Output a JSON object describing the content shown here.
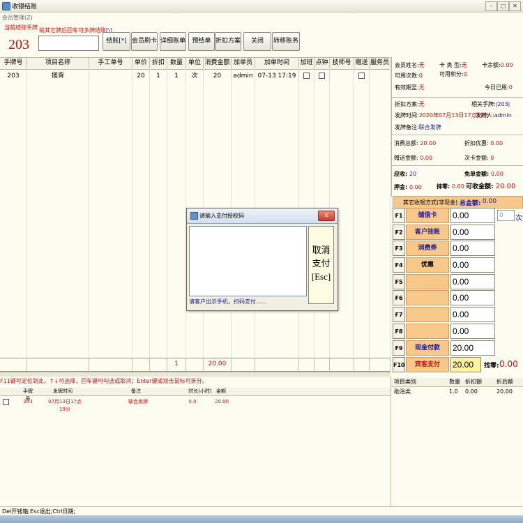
{
  "window": {
    "title": "收银结账"
  },
  "menu": {
    "label": "会员管理(Z)"
  },
  "header": {
    "current_label": "当前结账手牌",
    "current_number": "203",
    "hint_text": "输其它牌后回车可多牌结账",
    "hint_suffix": "[\\]",
    "code_value": ""
  },
  "toolbar": {
    "buttons": [
      {
        "label": "结账[*]"
      },
      {
        "label": "会员刷卡"
      },
      {
        "label": "详细账单"
      },
      {
        "label": "预结单"
      },
      {
        "label": "折扣方案"
      },
      {
        "label": "关闭"
      },
      {
        "label": "转移账务"
      }
    ]
  },
  "grid": {
    "columns": [
      "手牌号",
      "项目名称",
      "手工单号",
      "单价",
      "折扣",
      "数量",
      "单位",
      "消费金额",
      "加单员",
      "加单时间",
      "加班",
      "点钟",
      "技师号",
      "赠送",
      "服务员"
    ],
    "rows": [
      {
        "tag": "203",
        "item": "搓背",
        "manual": "",
        "price": "20",
        "discount": "1",
        "qty": "1",
        "unit": "次",
        "amount": "20",
        "operator": "admin",
        "time": "07-13 17:19",
        "tech": ""
      }
    ],
    "summary": {
      "qty": "1",
      "amount": "20.00"
    }
  },
  "member": {
    "name_label": "会员姓名:",
    "name_value": "无",
    "card_type_label": "卡 类 型:",
    "card_type_value": "无",
    "card_balance_label": "卡余额:",
    "card_balance_value": "0.00",
    "avail_times_label": "可用次数:",
    "avail_times_value": "0",
    "avail_points_label": "可用积分:",
    "avail_points_value": "0",
    "valid_label": "有效期至:",
    "valid_value": "无",
    "today_used_label": "今日已用:",
    "today_used_value": "0"
  },
  "order": {
    "plan_label": "折扣方案:",
    "plan_value": "无",
    "related_label": "相关手牌:",
    "related_value": "|203|",
    "time_label": "发牌时间:",
    "time_value": "2020年07月13日17点19分",
    "issuer_label": "发牌人:",
    "issuer_value": "admin",
    "note_label": "发牌备注:",
    "note_value": "联合发牌"
  },
  "totals": {
    "consume_label": "消费总额:",
    "consume_value": "20.00",
    "discount_label": "折扣优惠:",
    "discount_value": "0.00",
    "gift_label": "赠送金额:",
    "gift_value": "0.00",
    "card_label": "次卡金额:",
    "card_value": "0",
    "receivable_label": "应收:",
    "receivable_value": "20",
    "free_label": "免单金额:",
    "free_value": "0.00",
    "deposit_label": "押金:",
    "deposit_value": "0.00",
    "round_label": "抹零:",
    "round_value": "0.00",
    "collectable_label": "可收金额:",
    "collectable_value": "20.00"
  },
  "payment": {
    "other_label": "其它收银方式(非现金)",
    "total_label": "总金额:",
    "total_value": "0.00",
    "rows": [
      {
        "key": "F1",
        "name": "储值卡",
        "amount": "0.00"
      },
      {
        "key": "F2",
        "name": "客户挂账",
        "amount": "0.00"
      },
      {
        "key": "F3",
        "name": "消费券",
        "amount": "0.00"
      },
      {
        "key": "F4",
        "name": "优惠",
        "amount": "0.00"
      },
      {
        "key": "F5",
        "name": "",
        "amount": "0.00"
      },
      {
        "key": "F6",
        "name": "",
        "amount": "0.00"
      },
      {
        "key": "F7",
        "name": "",
        "amount": "0.00"
      },
      {
        "key": "F8",
        "name": "",
        "amount": "0.00"
      },
      {
        "key": "F9",
        "name": "现金付款",
        "amount": "20.00"
      },
      {
        "key": "F10",
        "name": "宾客支付",
        "amount": "20.00"
      }
    ],
    "stored_card_times": "0",
    "times_unit": "次",
    "change_label": "找零:",
    "change_value": "0.00"
  },
  "notice": {
    "text": "F11键可定位到此，↑↓可选择，回车键可勾选或取消；Enter键或双击鼠标可拆分。"
  },
  "sub_table": {
    "columns": [
      "手牌号",
      "发牌时间",
      "备注",
      "时长(小时)",
      "金额"
    ],
    "rows": [
      {
        "tag": "203",
        "time": "07月13日17点19分",
        "note": "联合发牌",
        "hours": "0.0",
        "amount": "20.00"
      }
    ]
  },
  "category_table": {
    "columns": [
      "项目类别",
      "数量",
      "折扣额",
      "折后额"
    ],
    "rows": [
      {
        "cat": "助浴类",
        "qty": "1.0",
        "disc": "0.00",
        "after": "20.00"
      }
    ]
  },
  "status": {
    "text": "Del开钱箱;Esc退出;Ctrl日期;"
  },
  "dialog": {
    "title": "请输入支付授权码",
    "cancel_line1": "取消",
    "cancel_line2": "支付",
    "cancel_line3": "[Esc]",
    "hint": "请客户出示手机，扫码支付......",
    "close": "x"
  },
  "colors": {
    "accent": "#c81010",
    "link": "#1a1a9c",
    "pay_label": "#f8c78a",
    "highlight": "#fff2a0"
  }
}
